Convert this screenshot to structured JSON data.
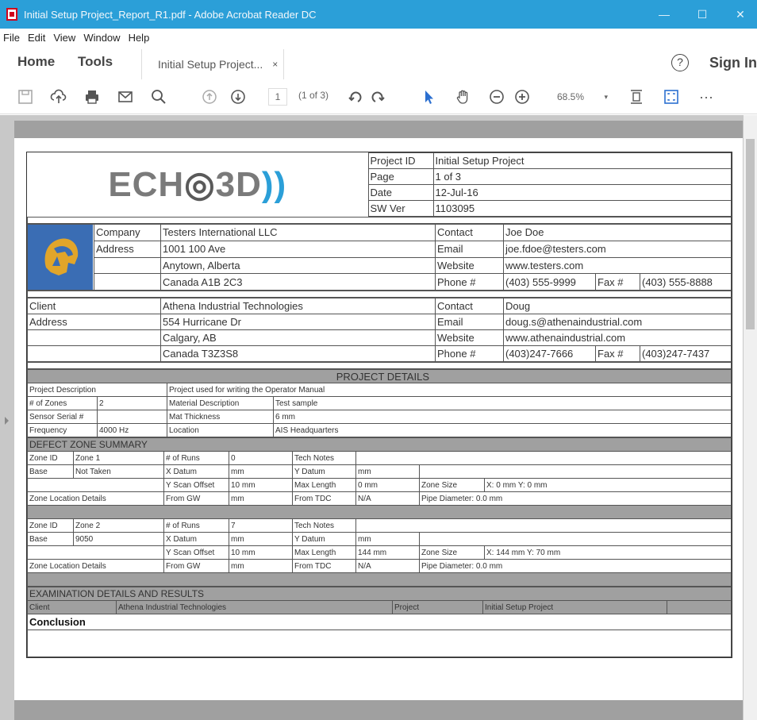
{
  "window": {
    "title": "Initial Setup Project_Report_R1.pdf - Adobe Acrobat Reader DC",
    "minimize": "—",
    "maximize": "☐",
    "close": "✕"
  },
  "menu": [
    "File",
    "Edit",
    "View",
    "Window",
    "Help"
  ],
  "nav": {
    "home": "Home",
    "tools": "Tools",
    "tab_label": "Initial Setup Project...",
    "tab_close": "×",
    "help": "?",
    "sign_in": "Sign In"
  },
  "toolbar": {
    "page_current": "1",
    "page_of": "(1 of 3)",
    "zoom": "68.5%",
    "more": "···"
  },
  "report": {
    "logo": {
      "letters_1": "ECH",
      "letter_o": "◎",
      "letters_2": "3D",
      "waves": "))"
    },
    "header": {
      "project_id_label": "Project ID",
      "project_id": "Initial Setup Project",
      "page_label": "Page",
      "page": "1 of 3",
      "date_label": "Date",
      "date": "12-Jul-16",
      "sw_label": "SW Ver",
      "sw": "1103095"
    },
    "company": {
      "company_label": "Company",
      "company": "Testers International LLC",
      "address_label": "Address",
      "address1": "1001 100 Ave",
      "address2": "Anytown, Alberta",
      "address3": "Canada A1B 2C3",
      "contact_label": "Contact",
      "contact": "Joe Doe",
      "email_label": "Email",
      "email": "joe.fdoe@testers.com",
      "website_label": "Website",
      "website": "www.testers.com",
      "phone_label": "Phone #",
      "phone": "(403) 555-9999",
      "fax_label": "Fax #",
      "fax": "(403) 555-8888"
    },
    "client": {
      "client_label": "Client",
      "client": "Athena Industrial Technologies",
      "address_label": "Address",
      "address1": "554 Hurricane Dr",
      "address2": "Calgary, AB",
      "address3": "Canada T3Z3S8",
      "contact_label": "Contact",
      "contact": "Doug",
      "email_label": "Email",
      "email": "doug.s@athenaindustrial.com",
      "website_label": "Website",
      "website": "www.athenaindustrial.com",
      "phone_label": "Phone #",
      "phone": "(403)247-7666",
      "fax_label": "Fax #",
      "fax": "(403)247-7437"
    },
    "project_details": {
      "heading": "PROJECT DETAILS",
      "desc_label": "Project Description",
      "desc": "Project used for writing the Operator Manual",
      "zones_label": "# of Zones",
      "zones": "2",
      "material_label": "Material Description",
      "material": "Test sample",
      "serial_label": "Sensor Serial #",
      "serial": "",
      "thickness_label": "Mat Thickness",
      "thickness": "6 mm",
      "freq_label": "Frequency",
      "freq": "4000 Hz",
      "location_label": "Location",
      "location": "AIS Headquarters"
    },
    "defect": {
      "heading": "DEFECT ZONE SUMMARY",
      "zones": [
        {
          "zone_id_label": "Zone ID",
          "zone_id": "Zone 1",
          "runs_label": "# of Runs",
          "runs": "0",
          "tech_label": "Tech Notes",
          "tech": "",
          "base_label": "Base",
          "base": "Not Taken",
          "xdatum_label": "X Datum",
          "xdatum": "mm",
          "ydatum_label": "Y Datum",
          "ydatum": "mm",
          "yscan_label": "Y Scan Offset",
          "yscan": "10 mm",
          "maxlen_label": "Max Length",
          "maxlen": "0 mm",
          "zsize_label": "Zone Size",
          "zsize": "X: 0 mm  Y: 0 mm",
          "loc_label": "Zone Location Details",
          "fromgw_label": "From GW",
          "fromgw": "mm",
          "fromtdc_label": "From TDC",
          "fromtdc": "N/A",
          "pipe": "Pipe Diameter: 0.0 mm"
        },
        {
          "zone_id_label": "Zone ID",
          "zone_id": "Zone 2",
          "runs_label": "# of Runs",
          "runs": "7",
          "tech_label": "Tech Notes",
          "tech": "",
          "base_label": "Base",
          "base": "9050",
          "xdatum_label": "X Datum",
          "xdatum": "mm",
          "ydatum_label": "Y Datum",
          "ydatum": "mm",
          "yscan_label": "Y Scan Offset",
          "yscan": "10 mm",
          "maxlen_label": "Max Length",
          "maxlen": "144 mm",
          "zsize_label": "Zone Size",
          "zsize": "X: 144 mm  Y: 70 mm",
          "loc_label": "Zone Location Details",
          "fromgw_label": "From GW",
          "fromgw": "mm",
          "fromtdc_label": "From TDC",
          "fromtdc": "N/A",
          "pipe": "Pipe Diameter: 0.0 mm"
        }
      ]
    },
    "exam": {
      "heading": "EXAMINATION DETAILS AND RESULTS",
      "client_label": "Client",
      "client": "Athena Industrial Technologies",
      "project_label": "Project",
      "project": "Initial Setup Project",
      "conclusion_label": "Conclusion"
    }
  }
}
